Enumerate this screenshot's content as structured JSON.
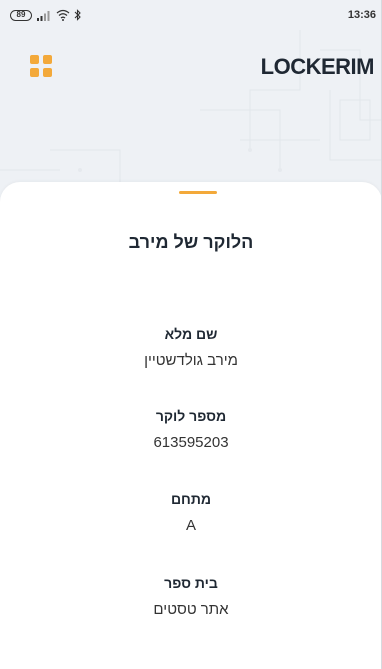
{
  "status_bar": {
    "battery": "89",
    "time": "13:36"
  },
  "header": {
    "logo": "LOCKERIM",
    "menu_icon": "grid-menu-icon",
    "accent_color": "#f3a93a"
  },
  "card": {
    "title": "הלוקר של מירב",
    "fields": [
      {
        "label": "שם מלא",
        "value": "מירב גולדשטיין"
      },
      {
        "label": "מספר לוקר",
        "value": "613595203"
      },
      {
        "label": "מתחם",
        "value": "A"
      },
      {
        "label": "בית ספר",
        "value": "אתר טסטים"
      }
    ]
  }
}
